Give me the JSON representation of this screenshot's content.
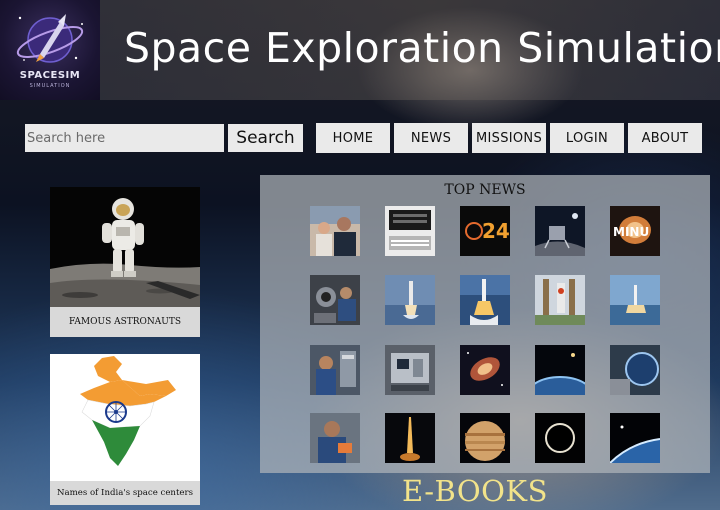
{
  "header": {
    "logo_text": "SPACESIM",
    "logo_subtext": "SIMULATION",
    "title": "Space Exploration Simulation"
  },
  "search": {
    "placeholder": "Search here",
    "button_label": "Search"
  },
  "nav": {
    "items": [
      {
        "label": "HOME"
      },
      {
        "label": "NEWS"
      },
      {
        "label": "MISSIONS"
      },
      {
        "label": "LOGIN"
      },
      {
        "label": "ABOUT"
      }
    ]
  },
  "cards": [
    {
      "caption": "FAMOUS ASTRONAUTS",
      "image": "astronaut-on-moon"
    },
    {
      "caption": "Names of India's space centers",
      "image": "india-flag-map"
    }
  ],
  "top_news": {
    "title": "TOP NEWS",
    "thumbnails": [
      {
        "name": "astronauts-group"
      },
      {
        "name": "sensor-array"
      },
      {
        "name": "eclipse-2024"
      },
      {
        "name": "moon-lander"
      },
      {
        "name": "minute-countdown"
      },
      {
        "name": "station-interior"
      },
      {
        "name": "rocket-launch-1"
      },
      {
        "name": "rocket-launch-2"
      },
      {
        "name": "launch-pad"
      },
      {
        "name": "launch-over-water"
      },
      {
        "name": "astronaut-at-work"
      },
      {
        "name": "spacecraft-module"
      },
      {
        "name": "galaxy"
      },
      {
        "name": "earth-horizon"
      },
      {
        "name": "earth-from-window"
      },
      {
        "name": "astronaut-portrait"
      },
      {
        "name": "night-launch"
      },
      {
        "name": "jupiter"
      },
      {
        "name": "black-hole"
      },
      {
        "name": "planet-edge"
      }
    ]
  },
  "ebooks": {
    "label": "E-BOOKS"
  }
}
